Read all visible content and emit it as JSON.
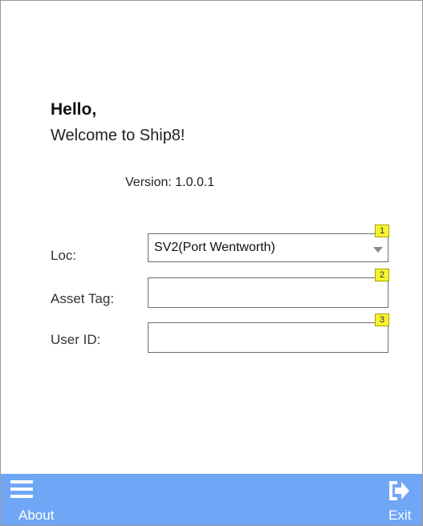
{
  "header": {
    "greeting": "Hello,",
    "welcome": "Welcome to Ship8!",
    "version": "Version: 1.0.0.1"
  },
  "form": {
    "loc": {
      "label": "Loc:",
      "value": "SV2(Port Wentworth)",
      "badge": "1"
    },
    "asset_tag": {
      "label": "Asset Tag:",
      "value": "",
      "badge": "2"
    },
    "user_id": {
      "label": "User ID:",
      "value": "",
      "badge": "3"
    }
  },
  "footer": {
    "about_label": "About",
    "exit_label": "Exit",
    "about_icon": "menu-icon",
    "exit_icon": "exit-icon",
    "color": "#6fa6f5"
  },
  "colors": {
    "badge": "#f5f232"
  }
}
